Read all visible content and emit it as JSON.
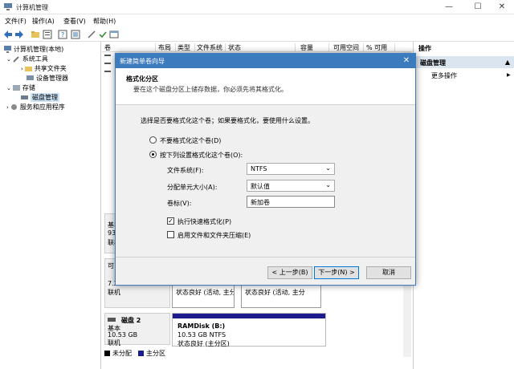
{
  "window": {
    "title": "计算机管理",
    "minimize": "—",
    "maximize": "☐",
    "close": "✕"
  },
  "menu": [
    "文件(F)",
    "操作(A)",
    "查看(V)",
    "帮助(H)"
  ],
  "tree": {
    "root": "计算机管理(本地)",
    "system_tools": "系统工具",
    "shared_folders": "共享文件夹",
    "device_manager": "设备管理器",
    "storage": "存储",
    "disk_management": "磁盘管理",
    "services": "服务和应用程序"
  },
  "list_headers": [
    "卷",
    "布局",
    "类型",
    "文件系统",
    "状态",
    "容量",
    "可用空间",
    "% 可用"
  ],
  "actions": {
    "header": "操作",
    "selected": "磁盘管理",
    "more": "更多操作",
    "more_arrow": "▶"
  },
  "disks": [
    {
      "lines": [
        "基本",
        "93",
        "联机"
      ]
    },
    {
      "lines": [
        "可",
        "7.2",
        "联机"
      ],
      "status1": "状态良好 (活动, 主分",
      "status2": "状态良好 (活动, 主分"
    },
    {
      "name": "磁盘 2",
      "type": "基本",
      "size": "10.53 GB",
      "state": "联机",
      "part_title": "RAMDisk  (B:)",
      "part_size": "10.53 GB NTFS",
      "part_status": "状态良好 (主分区)"
    }
  ],
  "legend": {
    "unallocated": "未分配",
    "primary": "主分区",
    "unalloc_color": "#000000",
    "primary_color": "#1c1c8c"
  },
  "dialog": {
    "title": "新建简单卷向导",
    "close": "✕",
    "heading": "格式化分区",
    "subheading": "要在这个磁盘分区上储存数据，你必须先将其格式化。",
    "instruction": "选择是否要格式化这个卷；如果要格式化，要使用什么设置。",
    "opt_no_format": "不要格式化这个卷(D)",
    "opt_format": "按下列设置格式化这个卷(O):",
    "fs_label": "文件系统(F):",
    "fs_value": "NTFS",
    "alloc_label": "分配单元大小(A):",
    "alloc_value": "默认值",
    "vol_label": "卷标(V):",
    "vol_value": "新加卷",
    "quick_format": "执行快速格式化(P)",
    "compress": "启用文件和文件夹压缩(E)",
    "back": "< 上一步(B)",
    "next": "下一步(N) >",
    "cancel": "取消"
  },
  "accent": "#3c7bbd"
}
